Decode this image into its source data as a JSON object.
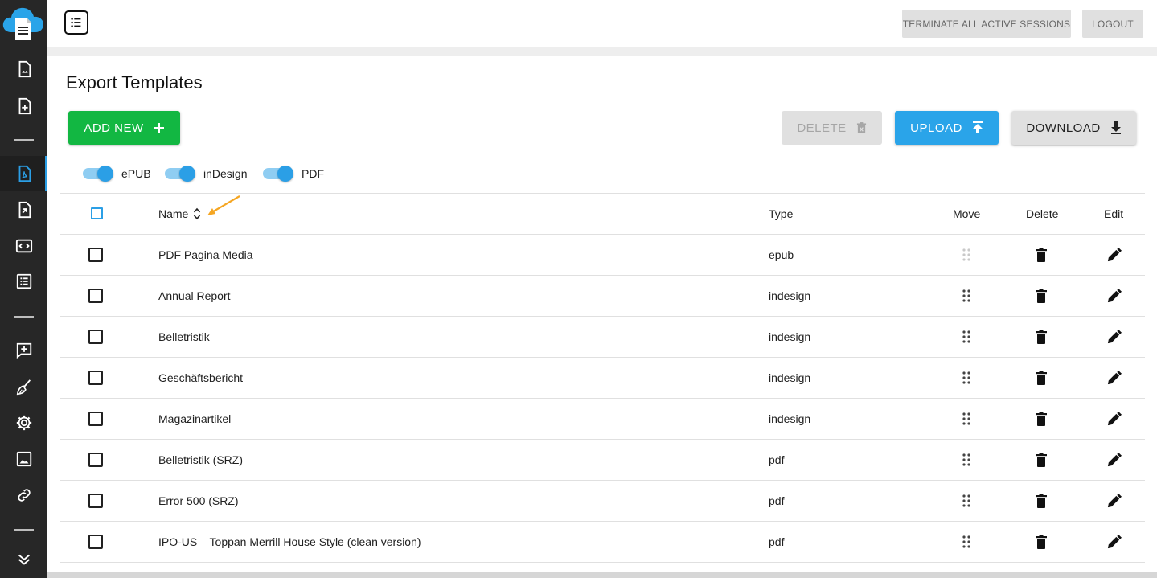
{
  "sidebar": {
    "logo": "cloud-document-logo",
    "items": [
      {
        "icon": "file-image-icon",
        "active": false
      },
      {
        "icon": "file-plus-icon",
        "active": false
      },
      {
        "icon": "file-pdf-icon",
        "active": true
      },
      {
        "icon": "file-export-icon",
        "active": false
      },
      {
        "icon": "code-icon",
        "active": false
      },
      {
        "icon": "list-box-icon",
        "active": false
      },
      {
        "icon": "message-plus-icon",
        "active": false
      },
      {
        "icon": "broom-icon",
        "active": false
      },
      {
        "icon": "gear-icon",
        "active": false
      },
      {
        "icon": "image-icon",
        "active": false
      },
      {
        "icon": "link-icon",
        "active": false
      },
      {
        "icon": "chevron-double-down-icon",
        "active": false
      }
    ]
  },
  "topbar": {
    "menu_icon": "list-toggle-icon",
    "terminate_label": "TERMINATE ALL ACTIVE SESSIONS",
    "logout_label": "LOGOUT"
  },
  "page": {
    "title": "Export Templates"
  },
  "toolbar": {
    "add_label": "ADD NEW",
    "delete_label": "DELETE",
    "upload_label": "UPLOAD",
    "download_label": "DOWNLOAD"
  },
  "filters": [
    {
      "label": "ePUB",
      "on": true
    },
    {
      "label": "inDesign",
      "on": true
    },
    {
      "label": "PDF",
      "on": true
    }
  ],
  "table": {
    "columns": {
      "name": "Name",
      "type": "Type",
      "move": "Move",
      "delete": "Delete",
      "edit": "Edit"
    },
    "rows": [
      {
        "name": "PDF Pagina Media",
        "type": "epub",
        "move_disabled": true
      },
      {
        "name": "Annual Report",
        "type": "indesign",
        "move_disabled": false
      },
      {
        "name": "Belletristik",
        "type": "indesign",
        "move_disabled": false
      },
      {
        "name": "Geschäftsbericht",
        "type": "indesign",
        "move_disabled": false
      },
      {
        "name": "Magazinartikel",
        "type": "indesign",
        "move_disabled": false
      },
      {
        "name": "Belletristik (SRZ)",
        "type": "pdf",
        "move_disabled": false
      },
      {
        "name": "Error 500 (SRZ)",
        "type": "pdf",
        "move_disabled": false
      },
      {
        "name": "IPO-US – Toppan Merrill House Style (clean version)",
        "type": "pdf",
        "move_disabled": false
      }
    ]
  },
  "colors": {
    "sidebar_bg": "#272727",
    "accent": "#2b9fe6",
    "add_green": "#12b742",
    "annotation_orange": "#f5a623"
  }
}
